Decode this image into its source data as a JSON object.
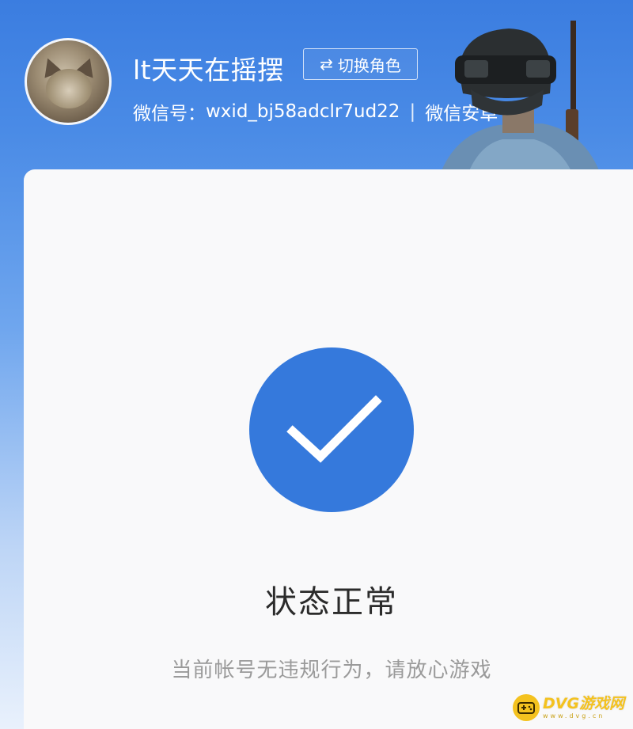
{
  "header": {
    "nickname": "lt天天在摇摆",
    "switch_role": {
      "icon": "swap-arrows-icon",
      "label": "切换角色"
    },
    "wechat_id_label": "微信号：",
    "wechat_id": "wxid_bj58adclr7ud22",
    "separator": "|",
    "platform": "微信安卓"
  },
  "status": {
    "icon": "check-icon",
    "title": "状态正常",
    "description": "当前帐号无违规行为，请放心游戏"
  },
  "watermark": {
    "text": "DVG游戏网",
    "sub": "www.dvg.cn"
  },
  "colors": {
    "header_blue": "#3b7de0",
    "check_circle": "#3579dc",
    "card_bg": "#f9f9fa",
    "watermark_yellow": "#f4c21f"
  }
}
